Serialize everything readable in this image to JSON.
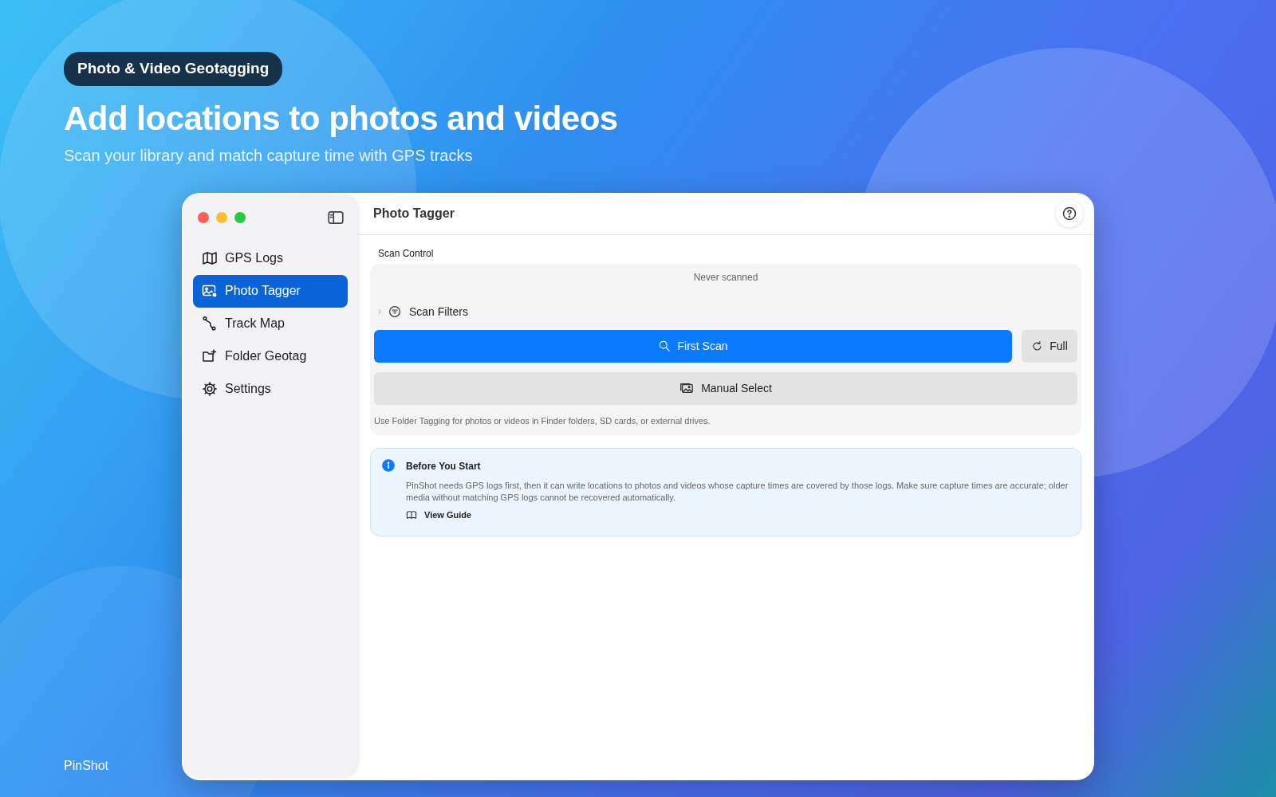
{
  "promo": {
    "badge": "Photo & Video Geotagging",
    "headline": "Add locations to photos and videos",
    "subtitle": "Scan your library and match capture time with GPS tracks",
    "brand": "PinShot"
  },
  "window": {
    "title": "Photo Tagger"
  },
  "sidebar": {
    "items": [
      {
        "label": "GPS Logs",
        "kind": "map",
        "selected": false
      },
      {
        "label": "Photo Tagger",
        "kind": "photo",
        "selected": true
      },
      {
        "label": "Track Map",
        "kind": "route",
        "selected": false
      },
      {
        "label": "Folder Geotag",
        "kind": "folder",
        "selected": false
      },
      {
        "label": "Settings",
        "kind": "gear",
        "selected": false
      }
    ]
  },
  "scan_control": {
    "label": "Scan Control",
    "status": "Never scanned",
    "filters": {
      "label": "Scan Filters",
      "expanded": false
    },
    "primary_button": "First Scan",
    "full_button": "Full",
    "manual_button": "Manual Select",
    "hint": "Use Folder Tagging for photos or videos in Finder folders, SD cards, or external drives."
  },
  "notice": {
    "title": "Before You Start",
    "body": "PinShot needs GPS logs first, then it can write locations to photos and videos whose capture times are covered by those logs. Make sure capture times are accurate; older media without matching GPS logs cannot be recovered automatically.",
    "link": "View Guide"
  }
}
